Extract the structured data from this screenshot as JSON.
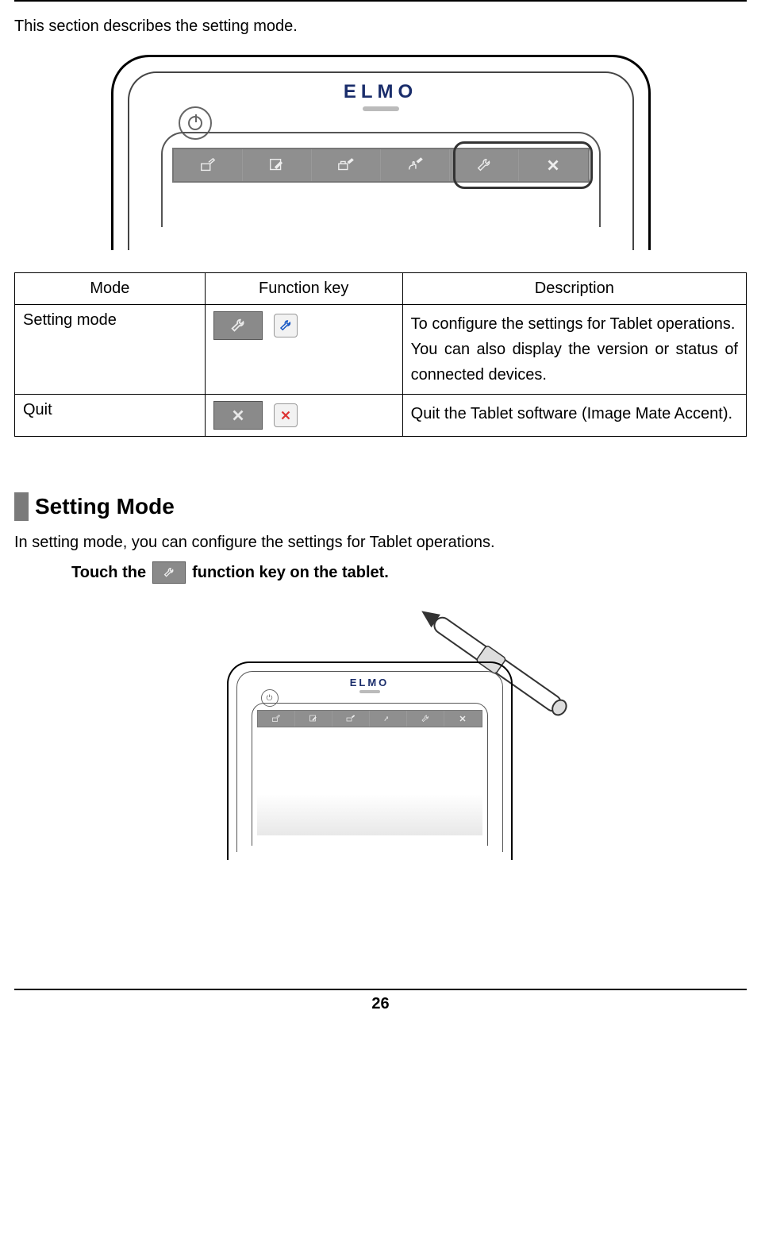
{
  "intro": "This section describes the setting mode.",
  "brand": "ELMO",
  "table": {
    "headers": {
      "mode": "Mode",
      "fnkey": "Function key",
      "desc": "Description"
    },
    "rows": [
      {
        "mode": "Setting mode",
        "desc": "To configure the settings for Tablet operations.\nYou can also display the version or status of connected devices."
      },
      {
        "mode": "Quit",
        "desc": "Quit the Tablet software (Image Mate Accent)."
      }
    ]
  },
  "section": {
    "title": "Setting Mode",
    "body": "In setting mode, you can configure the settings for Tablet operations.",
    "instruction_a": "Touch the",
    "instruction_b": "function key on the tablet."
  },
  "page_number": "26"
}
